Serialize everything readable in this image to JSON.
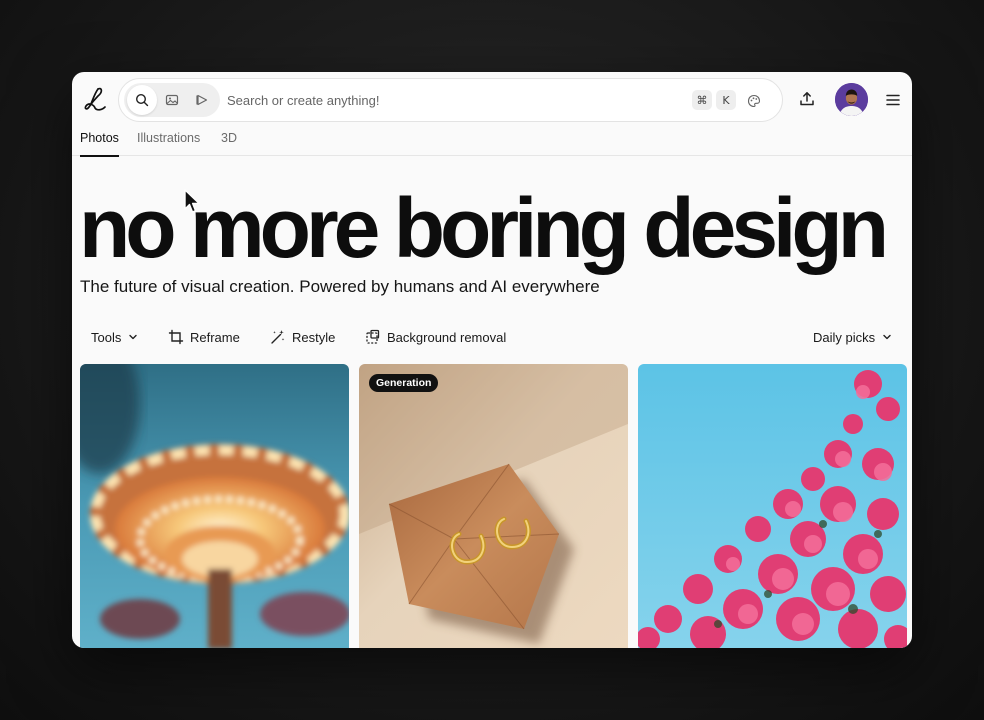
{
  "search": {
    "placeholder": "Search or create anything!",
    "shortcut_keys": [
      "⌘",
      "K"
    ],
    "modes": [
      "search-icon",
      "image-icon",
      "video-icon"
    ]
  },
  "tabs": [
    {
      "label": "Photos",
      "active": true
    },
    {
      "label": "Illustrations",
      "active": false
    },
    {
      "label": "3D",
      "active": false
    }
  ],
  "hero": {
    "title": "no more boring design",
    "subtitle": "The future of visual creation. Powered by humans and AI everywhere"
  },
  "toolbar": {
    "tools_label": "Tools",
    "reframe_label": "Reframe",
    "restyle_label": "Restyle",
    "background_removal_label": "Background removal",
    "sort_label": "Daily picks"
  },
  "gallery": [
    {
      "subject": "carousel ride",
      "badge": null
    },
    {
      "subject": "gold earrings on crumpled paper",
      "badge": "Generation"
    },
    {
      "subject": "pink bougainvillea against sky",
      "badge": null
    }
  ],
  "colors": {
    "accent": "#111111",
    "avatar_bg": "#5a3aa0",
    "window_bg": "#fafafa"
  }
}
